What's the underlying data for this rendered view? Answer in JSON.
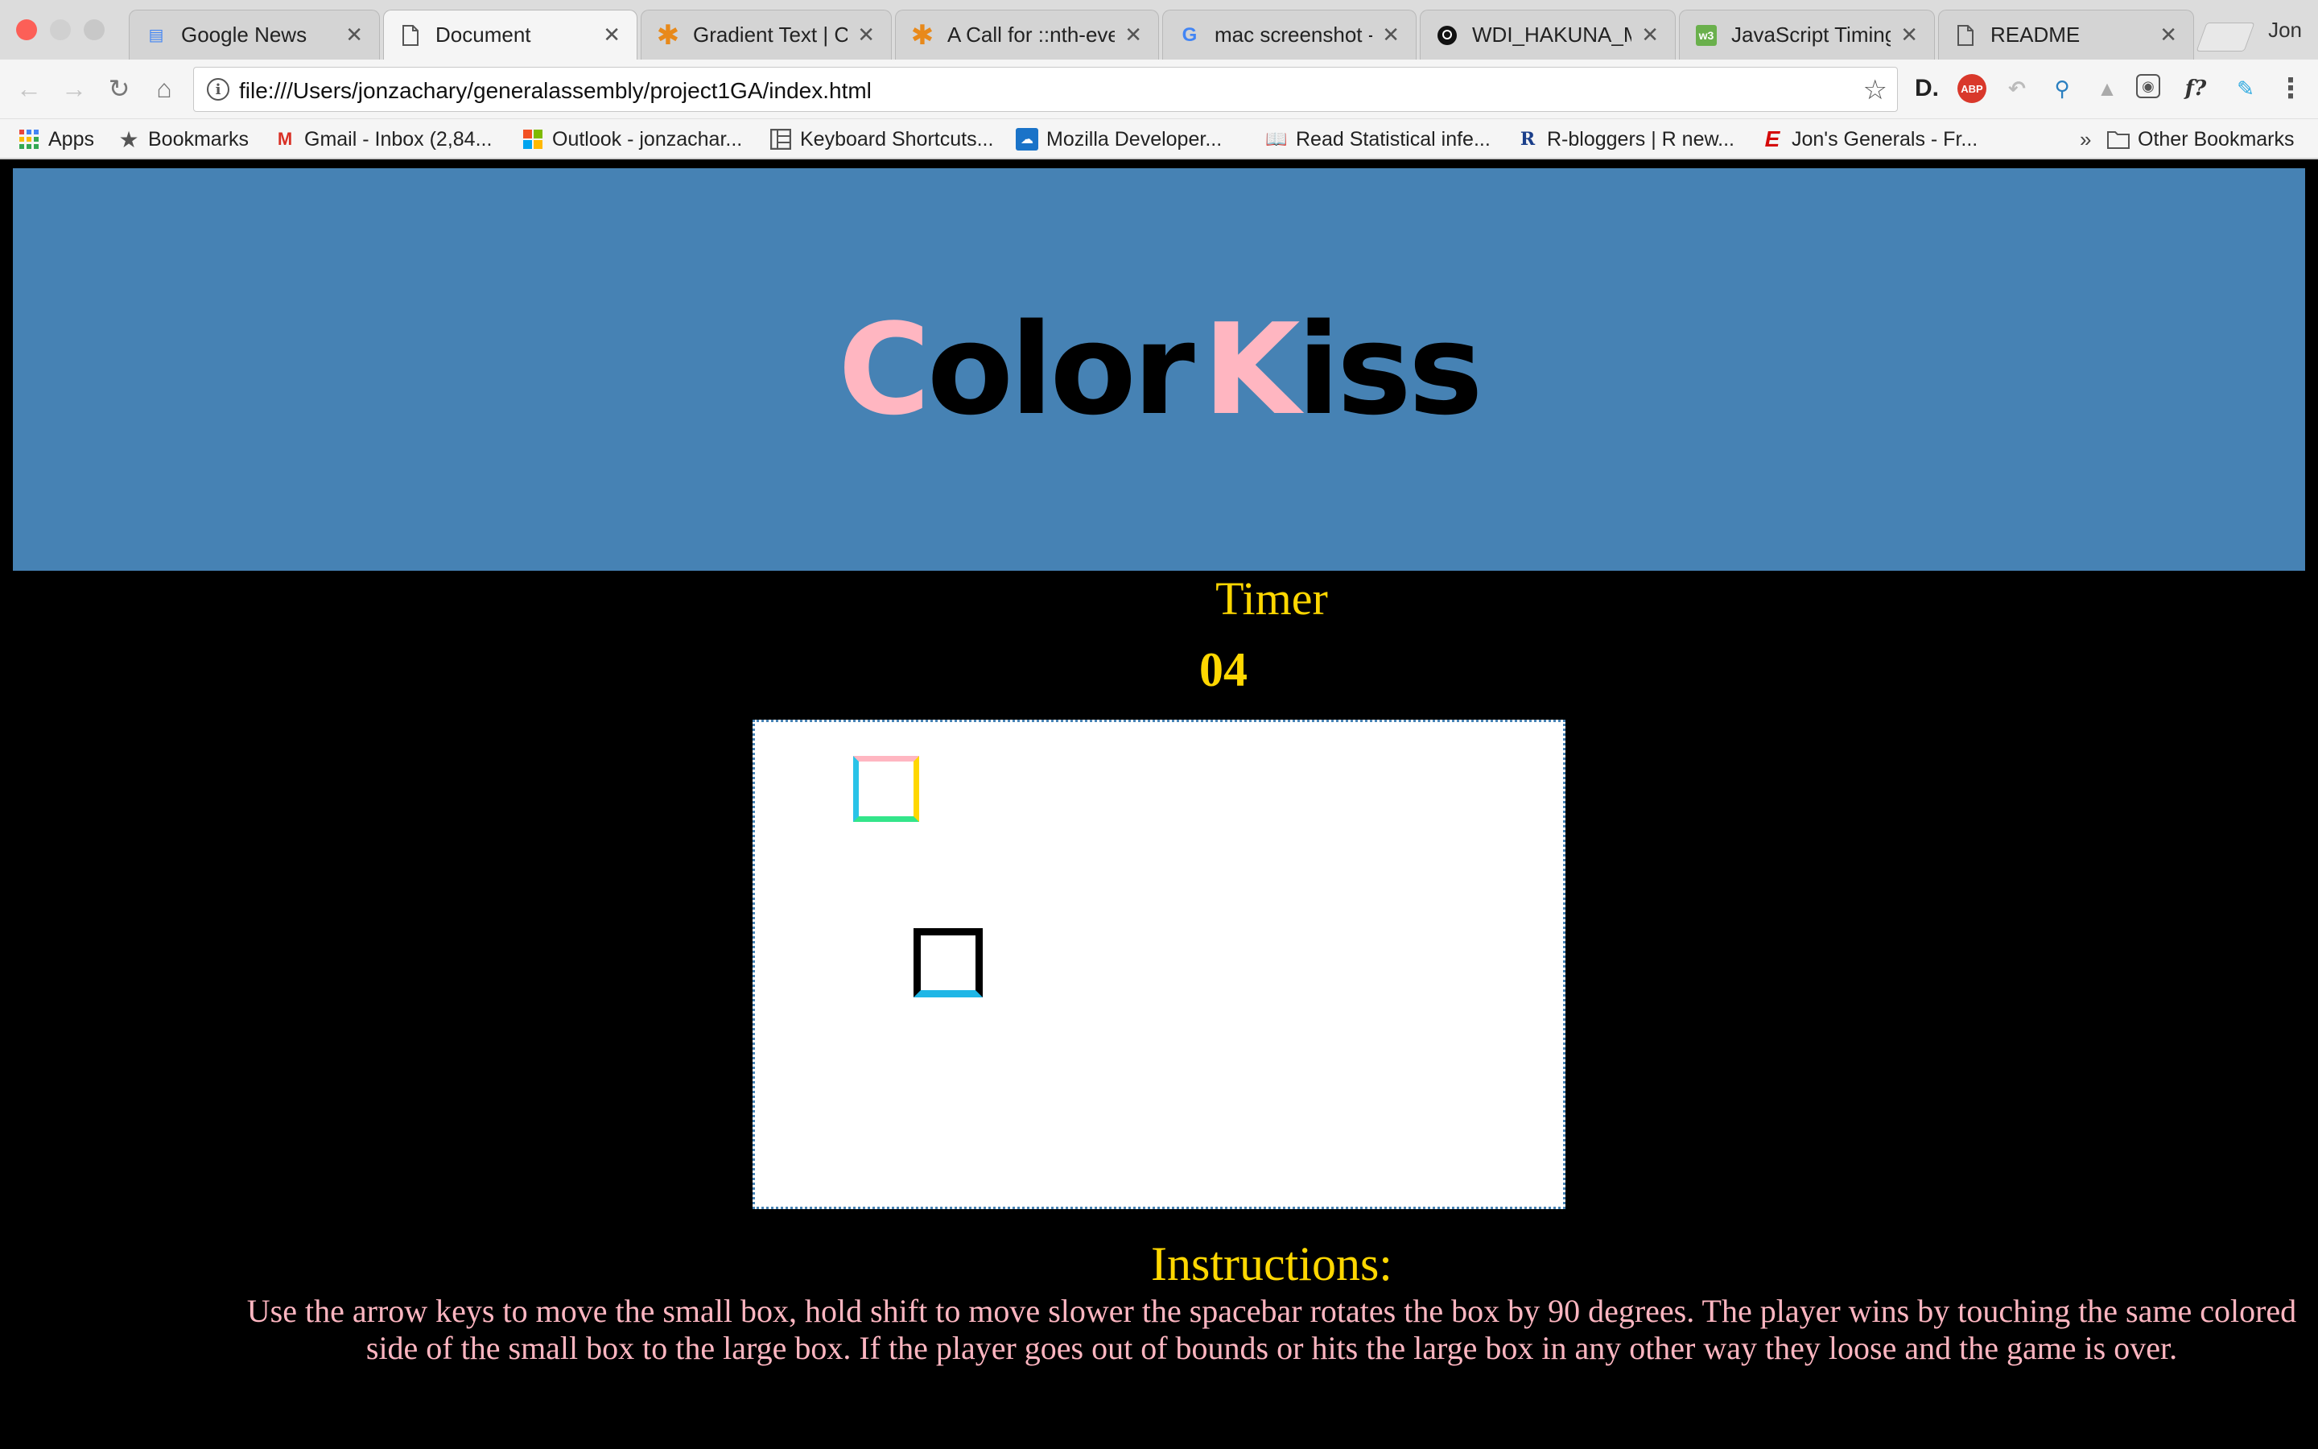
{
  "browser": {
    "tabs": [
      {
        "title": "Google News",
        "icon": "google-news-icon",
        "active": false
      },
      {
        "title": "Document",
        "icon": "document-icon",
        "active": true
      },
      {
        "title": "Gradient Text | CSS",
        "icon": "css-tricks-icon",
        "active": false
      },
      {
        "title": "A Call for ::nth-eve",
        "icon": "css-tricks-icon",
        "active": false
      },
      {
        "title": "mac screenshot - G",
        "icon": "google-icon",
        "active": false
      },
      {
        "title": "WDI_HAKUNA_MA",
        "icon": "github-icon",
        "active": false
      },
      {
        "title": "JavaScript Timing",
        "icon": "w3schools-icon",
        "active": false
      },
      {
        "title": "README",
        "icon": "document-icon",
        "active": false
      }
    ],
    "profile_name": "Jon",
    "url": "file:///Users/jonzachary/generalassembly/project1GA/index.html",
    "bookmarks": [
      {
        "label": "Apps",
        "icon": "apps-grid-icon"
      },
      {
        "label": "Bookmarks",
        "icon": "star-icon"
      },
      {
        "label": "Gmail - Inbox (2,84...",
        "icon": "gmail-icon"
      },
      {
        "label": "Outlook - jonzachar...",
        "icon": "microsoft-icon"
      },
      {
        "label": "Keyboard Shortcuts...",
        "icon": "keyboard-icon"
      },
      {
        "label": "Mozilla Developer...",
        "icon": "mdn-icon"
      },
      {
        "label": "Read Statistical infe...",
        "icon": "book-icon"
      },
      {
        "label": "R-bloggers | R new...",
        "icon": "r-icon"
      },
      {
        "label": "Jon's Generals - Fr...",
        "icon": "espn-icon"
      }
    ],
    "overflow_chevron": "»",
    "other_bookmarks": "Other Bookmarks"
  },
  "page": {
    "logo": {
      "c": "C",
      "olor": "olor",
      "k": "K",
      "iss": "iss"
    },
    "timer_label": "Timer",
    "timer_value": "04",
    "instructions_title": "Instructions:",
    "instructions_text": "Use the arrow keys to move the small box, hold shift to move slower the spacebar rotates the box by 90 degrees. The player wins by touching the same colored side of the small box to the large box. If the player goes out of bounds or hits the large box in any other way they loose and the game is over."
  },
  "colors": {
    "banner": "#4682b4",
    "logo_accent": "#ffb6c1",
    "timer": "#ffd700",
    "instructions_text": "#ffb6c1",
    "small_box_sides": {
      "top": "#ffb6c1",
      "right": "#ffd700",
      "bottom": "#33e58a",
      "left": "#29c3e8"
    },
    "large_box_sides": {
      "top": "#000000",
      "right": "#000000",
      "bottom": "#1fb6e6",
      "left": "#000000"
    }
  }
}
